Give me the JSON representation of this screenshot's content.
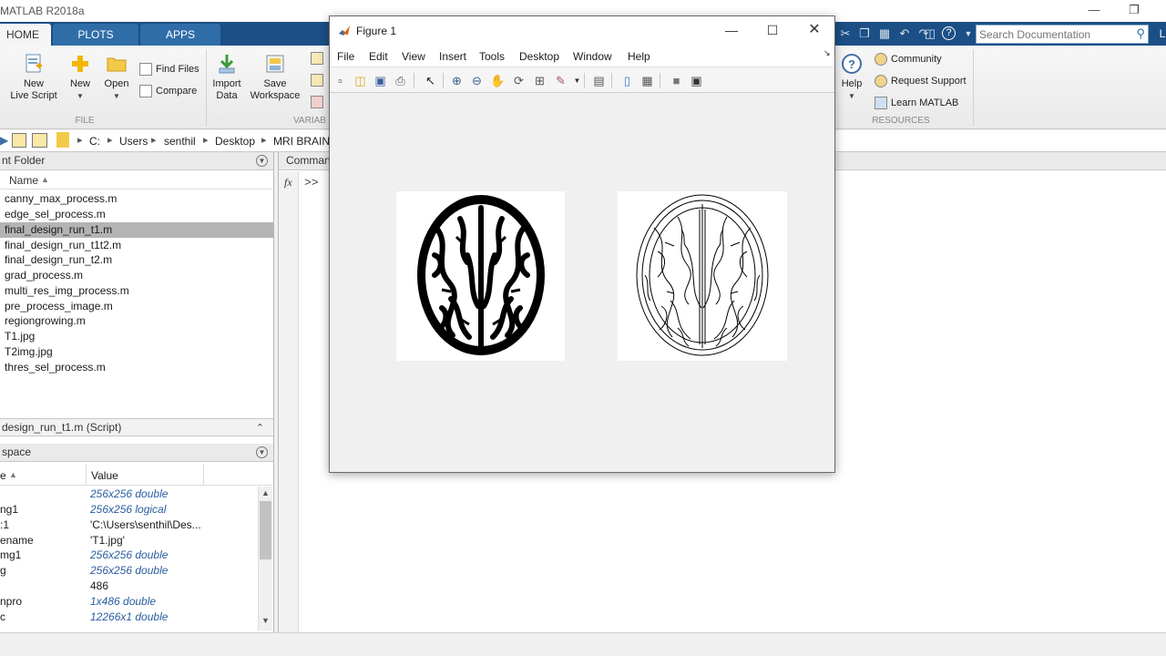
{
  "window": {
    "title": "MATLAB R2018a"
  },
  "tabs": [
    {
      "label": "HOME",
      "active": true
    },
    {
      "label": "PLOTS",
      "active": false
    },
    {
      "label": "APPS",
      "active": false
    }
  ],
  "search": {
    "placeholder": "Search Documentation"
  },
  "ribbon": {
    "new_live_script": "New\nLive Script",
    "new": "New",
    "open": "Open",
    "find_files": "Find Files",
    "compare": "Compare",
    "import_data": "Import\nData",
    "save_workspace": "Save\nWorkspace",
    "file_group": "FILE",
    "variable_group": "VARIAB",
    "help": "Help",
    "community": "Community",
    "request_support": "Request Support",
    "learn_matlab": "Learn MATLAB",
    "resources_group": "RESOURCES"
  },
  "address": {
    "segments": [
      "C:",
      "Users",
      "senthil",
      "Desktop",
      "MRI BRAIN"
    ]
  },
  "current_folder": {
    "title": "nt Folder",
    "column": "Name",
    "files": [
      {
        "name": "canny_max_process.m"
      },
      {
        "name": "edge_sel_process.m"
      },
      {
        "name": "final_design_run_t1.m",
        "selected": true
      },
      {
        "name": "final_design_run_t1t2.m"
      },
      {
        "name": "final_design_run_t2.m"
      },
      {
        "name": "grad_process.m"
      },
      {
        "name": "multi_res_img_process.m"
      },
      {
        "name": "pre_process_image.m"
      },
      {
        "name": "regiongrowing.m"
      },
      {
        "name": "T1.jpg"
      },
      {
        "name": "T2img.jpg"
      },
      {
        "name": "thres_sel_process.m"
      }
    ]
  },
  "details": {
    "label": "design_run_t1.m  (Script)"
  },
  "workspace": {
    "title": "space",
    "col_name": "e",
    "col_value": "Value",
    "rows": [
      {
        "name": "",
        "value": "256x256 double",
        "typed": true
      },
      {
        "name": "ng1",
        "value": "256x256 logical",
        "typed": true
      },
      {
        "name": ":1",
        "value": "'C:\\Users\\senthil\\Des...",
        "typed": false
      },
      {
        "name": "ename",
        "value": "'T1.jpg'",
        "typed": false
      },
      {
        "name": "mg1",
        "value": "256x256 double",
        "typed": true
      },
      {
        "name": "g",
        "value": "256x256 double",
        "typed": true
      },
      {
        "name": "",
        "value": "486",
        "typed": false
      },
      {
        "name": "npro",
        "value": "1x486 double",
        "typed": true
      },
      {
        "name": "c",
        "value": "12266x1 double",
        "typed": true
      }
    ]
  },
  "command_window": {
    "title": "Command",
    "prompt": ">>",
    "fx": "fx"
  },
  "figure": {
    "title": "Figure 1",
    "menus": [
      "File",
      "Edit",
      "View",
      "Insert",
      "Tools",
      "Desktop",
      "Window",
      "Help"
    ]
  },
  "colors": {
    "tabstrip": "#1b4f86",
    "accent": "#2f6da9",
    "selection": "#b4b4b4",
    "typed_value": "#2a5d9f"
  }
}
